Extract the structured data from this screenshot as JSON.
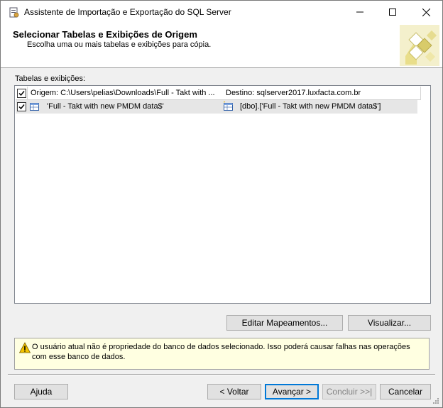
{
  "window": {
    "title": "Assistente de Importação e Exportação do SQL Server",
    "controls": [
      "minimize-icon",
      "maximize-icon",
      "close-icon"
    ]
  },
  "header": {
    "title": "Selecionar Tabelas e Exibições de Origem",
    "subtitle": "Escolha uma ou mais tabelas e exibições para cópia."
  },
  "tables": {
    "label": "Tabelas e exibições:",
    "columns": {
      "source": "Origem: C:\\Users\\pelias\\Downloads\\Full - Takt with ...",
      "destination": "Destino: sqlserver2017.luxfacta.com.br"
    },
    "rows": [
      {
        "checked": true,
        "source": "'Full - Takt with new PMDM data$'",
        "destination": "[dbo].['Full - Takt with new PMDM data$']"
      }
    ]
  },
  "buttons": {
    "edit_mappings": "Editar Mapeamentos...",
    "preview": "Visualizar...",
    "help": "Ajuda",
    "back": "< Voltar",
    "next": "Avançar >",
    "finish": "Concluir >>|",
    "cancel": "Cancelar"
  },
  "warning": {
    "text": "O usuário atual não é propriedade do banco de dados selecionado. Isso poderá causar falhas nas operações com esse banco de dados."
  },
  "colors": {
    "warning_bg": "#ffffe1",
    "selected_row": "#e6e6e6",
    "default_button_border": "#0078d7"
  }
}
